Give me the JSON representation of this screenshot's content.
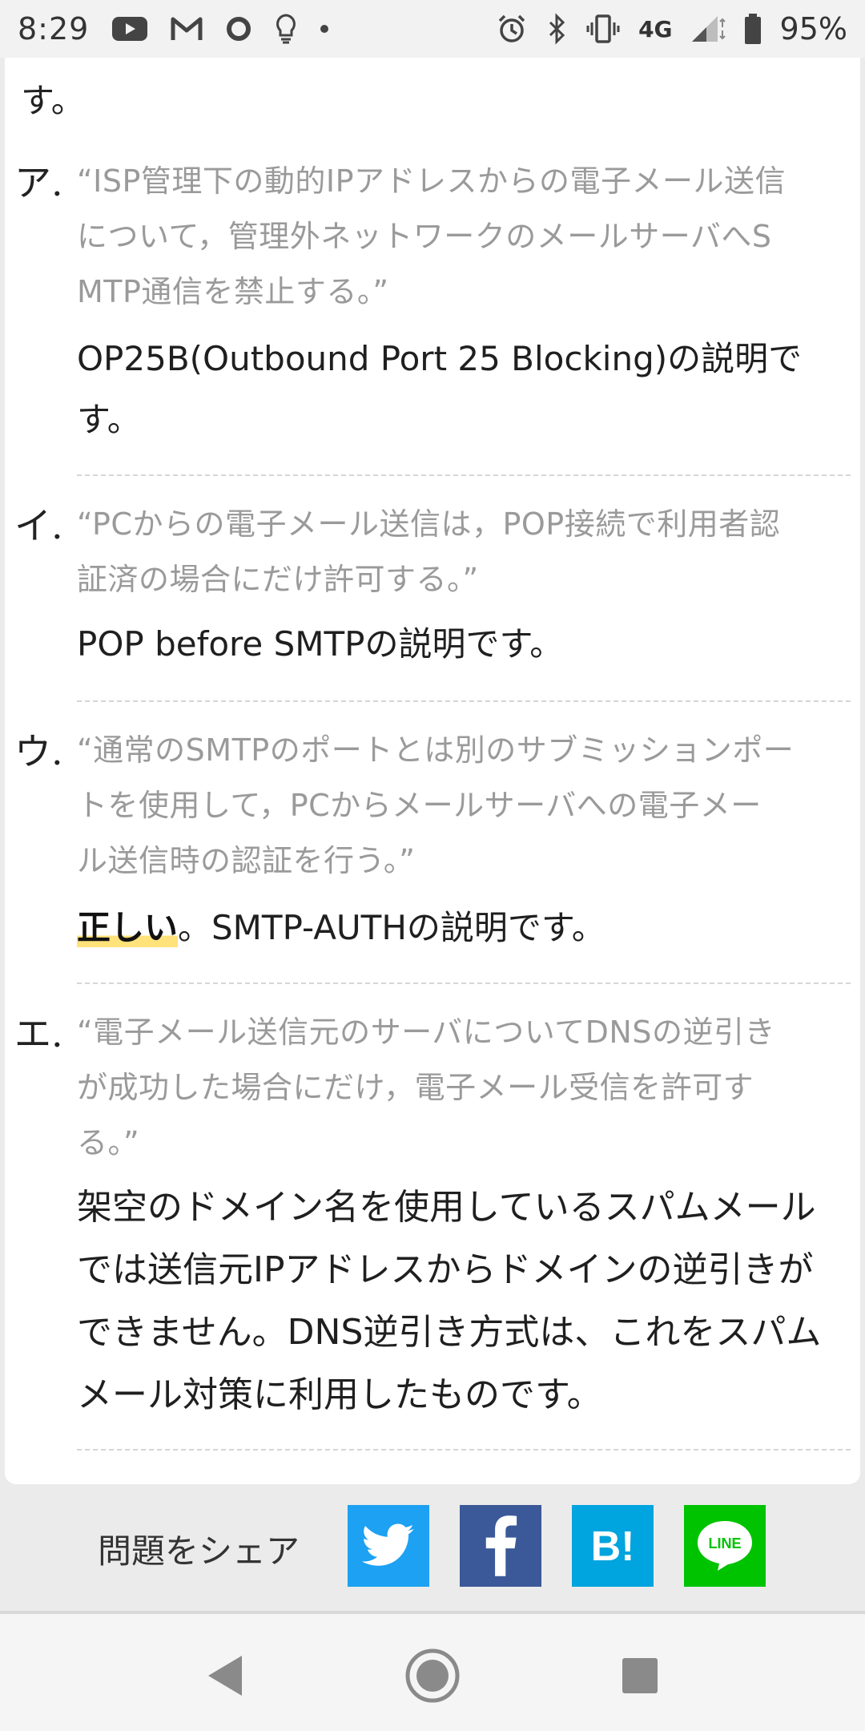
{
  "status_bar": {
    "time": "8:29",
    "network": "4G",
    "battery": "95%"
  },
  "content": {
    "intro_text": "す。",
    "items": [
      {
        "marker": "ア.",
        "quote_lines": [
          "“ISP管理下の動的IPアドレスからの電子メール送信",
          "について，管理外ネットワークのメールサーバへS",
          "MTP通信を禁止する。”"
        ],
        "answer_lines": [
          "OP25B(Outbound Port 25 Blocking)の説明で",
          "す。"
        ]
      },
      {
        "marker": "イ.",
        "quote_lines": [
          "“PCからの電子メール送信は，POP接続で利用者認",
          "証済の場合にだけ許可する。”"
        ],
        "answer_lines": [
          "POP before SMTPの説明です。"
        ]
      },
      {
        "marker": "ウ.",
        "quote_lines": [
          "“通常のSMTPのポートとは別のサブミッションポー",
          "トを使用して，PCからメールサーバへの電子メー",
          "ル送信時の認証を行う。”"
        ],
        "answer_correct": "正しい",
        "answer_rest": "。SMTP-AUTHの説明です。"
      },
      {
        "marker": "エ.",
        "quote_lines": [
          "“電子メール送信元のサーバについてDNSの逆引き",
          "が成功した場合にだけ，電子メール受信を許可す",
          "る。”"
        ],
        "answer_lines": [
          "架空のドメイン名を使用しているスパムメール",
          "では送信元IPアドレスからドメインの逆引きが",
          "できません。DNS逆引き方式は、これをスパム",
          "メール対策に利用したものです。"
        ]
      }
    ]
  },
  "share": {
    "label": "問題をシェア",
    "buttons": [
      {
        "name": "twitter",
        "icon": "twitter-bird-icon",
        "color": "#1da1f2"
      },
      {
        "name": "facebook",
        "icon": "facebook-f-icon",
        "color": "#3b5998"
      },
      {
        "name": "hatena",
        "icon": "hatena-bookmark-icon",
        "glyph": "B!",
        "color": "#00a4de"
      },
      {
        "name": "line",
        "icon": "line-icon",
        "glyph": "LINE",
        "color": "#00c300"
      }
    ]
  },
  "colors": {
    "quote_text": "#9a9a9a",
    "answer_text": "#1f1f1f",
    "highlight": "#ffe27a"
  }
}
